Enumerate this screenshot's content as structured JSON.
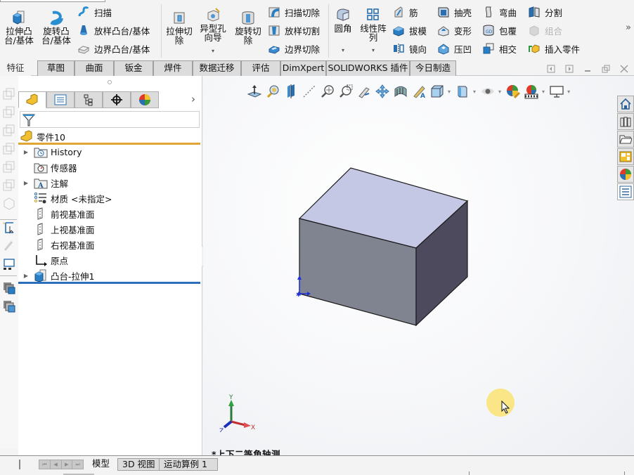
{
  "ribbon": {
    "big_buttons": [
      {
        "label": "拉伸凸\n台/基体",
        "icon": "extruded-boss-icon"
      },
      {
        "label": "旋转凸\n台/基体",
        "icon": "revolved-boss-icon"
      },
      {
        "label": "拉伸切\n除",
        "icon": "extruded-cut-icon"
      },
      {
        "label": "异型孔\n向导",
        "icon": "hole-wizard-icon"
      },
      {
        "label": "旋转切\n除",
        "icon": "revolved-cut-icon"
      },
      {
        "label": "圆角",
        "icon": "fillet-icon"
      },
      {
        "label": "线性阵\n列",
        "icon": "linear-pattern-icon"
      }
    ],
    "small_buttons": [
      {
        "label": "扫描",
        "icon": "sweep-icon"
      },
      {
        "label": "放样凸台/基体",
        "icon": "loft-icon"
      },
      {
        "label": "边界凸台/基体",
        "icon": "boundary-boss-icon"
      },
      {
        "label": "扫描切除",
        "icon": "swept-cut-icon"
      },
      {
        "label": "放样切割",
        "icon": "lofted-cut-icon"
      },
      {
        "label": "边界切除",
        "icon": "boundary-cut-icon"
      },
      {
        "label": "筋",
        "icon": "rib-icon"
      },
      {
        "label": "拔模",
        "icon": "draft-icon"
      },
      {
        "label": "镜向",
        "icon": "mirror-icon"
      },
      {
        "label": "抽壳",
        "icon": "shell-icon"
      },
      {
        "label": "变形",
        "icon": "deform-icon"
      },
      {
        "label": "压凹",
        "icon": "indent-icon"
      },
      {
        "label": "弯曲",
        "icon": "flex-icon"
      },
      {
        "label": "包覆",
        "icon": "wrap-icon"
      },
      {
        "label": "相交",
        "icon": "intersect-icon"
      },
      {
        "label": "分割",
        "icon": "split-icon"
      },
      {
        "label": "组合",
        "icon": "combine-icon",
        "disabled": true
      },
      {
        "label": "插入零件",
        "icon": "insert-part-icon"
      }
    ],
    "more": "»"
  },
  "tabs": [
    "特征",
    "草图",
    "曲面",
    "钣金",
    "焊件",
    "数据迁移",
    "评估",
    "DimXpert",
    "SOLIDWORKS 插件",
    "今日制造"
  ],
  "active_tab": "特征",
  "feature_manager": {
    "root": "零件10",
    "items": [
      {
        "label": "History",
        "icon": "history-folder-icon",
        "expandable": true
      },
      {
        "label": "传感器",
        "icon": "sensors-folder-icon",
        "expandable": false
      },
      {
        "label": "注解",
        "icon": "annotations-folder-icon",
        "expandable": true
      },
      {
        "label": "材质 <未指定>",
        "icon": "material-icon",
        "expandable": false
      },
      {
        "label": "前视基准面",
        "icon": "plane-icon",
        "expandable": false
      },
      {
        "label": "上视基准面",
        "icon": "plane-icon",
        "expandable": false
      },
      {
        "label": "右视基准面",
        "icon": "plane-icon",
        "expandable": false
      },
      {
        "label": "原点",
        "icon": "origin-icon",
        "expandable": false
      },
      {
        "label": "凸台-拉伸1",
        "icon": "boss-extrude-icon",
        "expandable": true
      }
    ],
    "more": "›"
  },
  "viewport": {
    "view_label": "*上下二等角轴测",
    "triad": {
      "x": "X",
      "y": "Y",
      "z": "Z"
    }
  },
  "bottom_tabs": [
    "模型",
    "3D 视图",
    "运动算例 1"
  ],
  "active_bottom_tab": "模型",
  "colors": {
    "root_underline": "#e0a534",
    "rollback_bar": "#2d6ebc",
    "box_top": "#c3c8e6",
    "box_front": "#7f8390",
    "box_right": "#4f4a5e"
  }
}
